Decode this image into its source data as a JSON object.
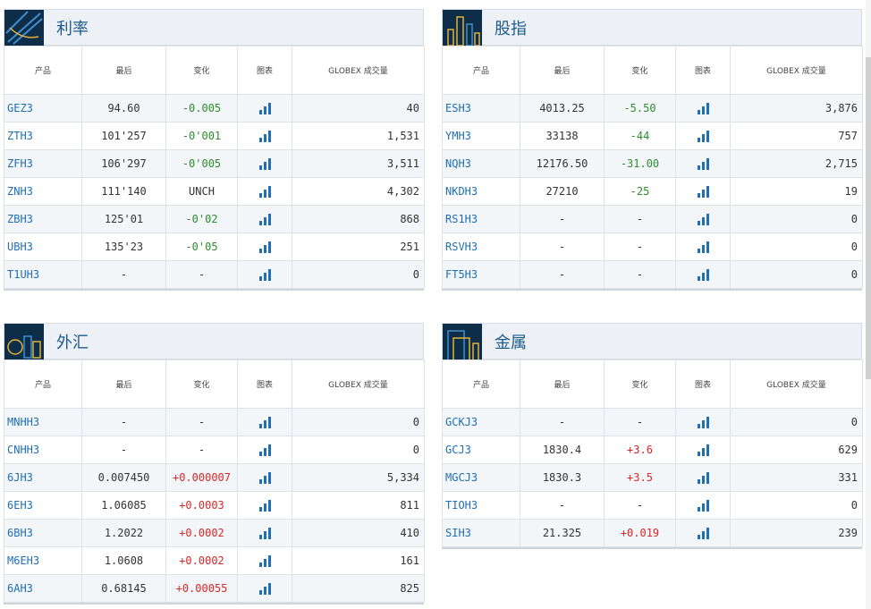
{
  "columns": {
    "product": "产品",
    "last": "最后",
    "change": "变化",
    "chart": "图表",
    "volume": "GLOBEX 成交量"
  },
  "panels": [
    {
      "title": "利率",
      "rows": [
        {
          "symbol": "GEZ3",
          "last": "94.60",
          "change": "-0.005",
          "dir": "neg",
          "volume": "40"
        },
        {
          "symbol": "ZTH3",
          "last": "101'257",
          "change": "-0'001",
          "dir": "neg",
          "volume": "1,531"
        },
        {
          "symbol": "ZFH3",
          "last": "106'297",
          "change": "-0'005",
          "dir": "neg",
          "volume": "3,511"
        },
        {
          "symbol": "ZNH3",
          "last": "111'140",
          "change": "UNCH",
          "dir": "flat",
          "volume": "4,302"
        },
        {
          "symbol": "ZBH3",
          "last": "125'01",
          "change": "-0'02",
          "dir": "neg",
          "volume": "868"
        },
        {
          "symbol": "UBH3",
          "last": "135'23",
          "change": "-0'05",
          "dir": "neg",
          "volume": "251"
        },
        {
          "symbol": "T1UH3",
          "last": "-",
          "change": "-",
          "dir": "flat",
          "volume": "0"
        }
      ]
    },
    {
      "title": "股指",
      "rows": [
        {
          "symbol": "ESH3",
          "last": "4013.25",
          "change": "-5.50",
          "dir": "neg",
          "volume": "3,876"
        },
        {
          "symbol": "YMH3",
          "last": "33138",
          "change": "-44",
          "dir": "neg",
          "volume": "757"
        },
        {
          "symbol": "NQH3",
          "last": "12176.50",
          "change": "-31.00",
          "dir": "neg",
          "volume": "2,715"
        },
        {
          "symbol": "NKDH3",
          "last": "27210",
          "change": "-25",
          "dir": "neg",
          "volume": "19"
        },
        {
          "symbol": "RS1H3",
          "last": "-",
          "change": "-",
          "dir": "flat",
          "volume": "0"
        },
        {
          "symbol": "RSVH3",
          "last": "-",
          "change": "-",
          "dir": "flat",
          "volume": "0"
        },
        {
          "symbol": "FT5H3",
          "last": "-",
          "change": "-",
          "dir": "flat",
          "volume": "0"
        }
      ]
    },
    {
      "title": "外汇",
      "rows": [
        {
          "symbol": "MNHH3",
          "last": "-",
          "change": "-",
          "dir": "flat",
          "volume": "0"
        },
        {
          "symbol": "CNHH3",
          "last": "-",
          "change": "-",
          "dir": "flat",
          "volume": "0"
        },
        {
          "symbol": "6JH3",
          "last": "0.007450",
          "change": "+0.000007",
          "dir": "pos",
          "volume": "5,334"
        },
        {
          "symbol": "6EH3",
          "last": "1.06085",
          "change": "+0.0003",
          "dir": "pos",
          "volume": "811"
        },
        {
          "symbol": "6BH3",
          "last": "1.2022",
          "change": "+0.0002",
          "dir": "pos",
          "volume": "410"
        },
        {
          "symbol": "M6EH3",
          "last": "1.0608",
          "change": "+0.0002",
          "dir": "pos",
          "volume": "161"
        },
        {
          "symbol": "6AH3",
          "last": "0.68145",
          "change": "+0.00055",
          "dir": "pos",
          "volume": "825"
        }
      ]
    },
    {
      "title": "金属",
      "rows": [
        {
          "symbol": "GCKJ3",
          "last": "-",
          "change": "-",
          "dir": "flat",
          "volume": "0"
        },
        {
          "symbol": "GCJ3",
          "last": "1830.4",
          "change": "+3.6",
          "dir": "pos",
          "volume": "629"
        },
        {
          "symbol": "MGCJ3",
          "last": "1830.3",
          "change": "+3.5",
          "dir": "pos",
          "volume": "331"
        },
        {
          "symbol": "TIOH3",
          "last": "-",
          "change": "-",
          "dir": "flat",
          "volume": "0"
        },
        {
          "symbol": "SIH3",
          "last": "21.325",
          "change": "+0.019",
          "dir": "pos",
          "volume": "239"
        }
      ]
    }
  ]
}
